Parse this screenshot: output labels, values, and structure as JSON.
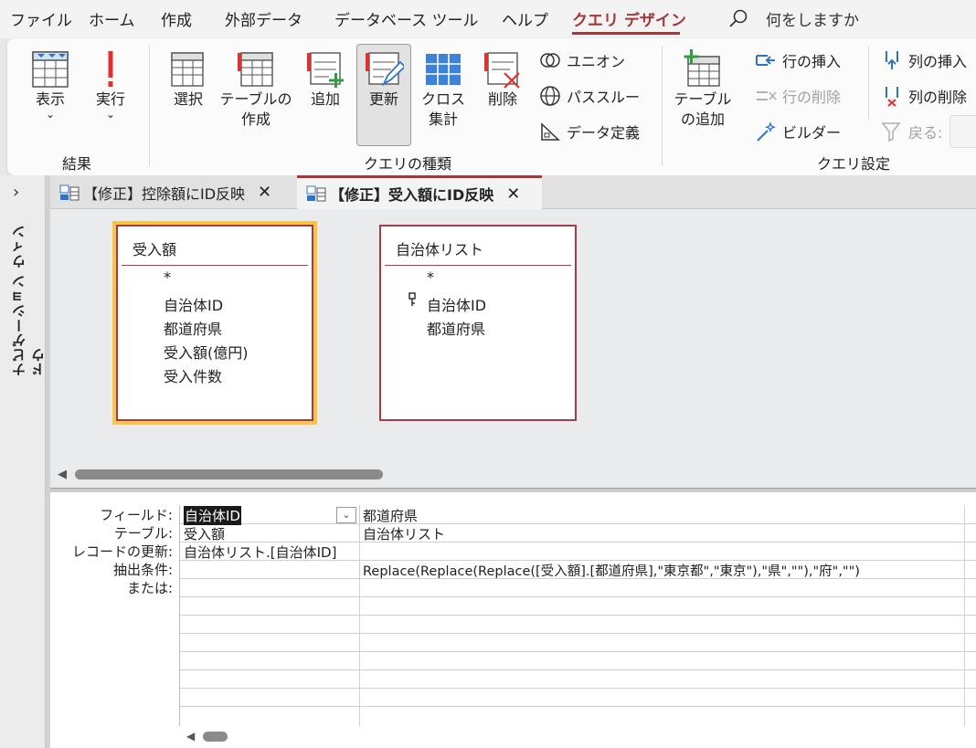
{
  "menu": {
    "file": "ファイル",
    "home": "ホーム",
    "create": "作成",
    "external": "外部データ",
    "dbtools": "データベース ツール",
    "help": "ヘルプ",
    "query_design": "クエリ デザイン",
    "search_placeholder": "何をしますか"
  },
  "ribbon": {
    "results": {
      "view": "表示",
      "run": "実行",
      "group": "結果"
    },
    "query_type": {
      "select": "選択",
      "make_table_1": "テーブルの",
      "make_table_2": "作成",
      "append": "追加",
      "update": "更新",
      "crosstab_1": "クロス",
      "crosstab_2": "集計",
      "delete": "削除",
      "union": "ユニオン",
      "passthrough": "パススルー",
      "data_definition": "データ定義",
      "group": "クエリの種類"
    },
    "query_setup": {
      "add_table_1": "テーブル",
      "add_table_2": "の追加",
      "insert_rows": "行の挿入",
      "delete_rows": "行の削除",
      "builder": "ビルダー",
      "insert_columns": "列の挿入",
      "delete_columns": "列の削除",
      "return": "戻る:",
      "group": "クエリ設定"
    }
  },
  "nav": {
    "title": "ナビゲーション ウィンドウ"
  },
  "tabs": [
    {
      "label": "【修正】控除額にID反映"
    },
    {
      "label": "【修正】受入額にID反映"
    }
  ],
  "tables": [
    {
      "title": "受入額",
      "fields": [
        "*",
        "自治体ID",
        "都道府県",
        "受入額(億円)",
        "受入件数"
      ]
    },
    {
      "title": "自治体リスト",
      "fields": [
        "*",
        "自治体ID",
        "都道府県"
      ]
    }
  ],
  "grid": {
    "row_labels": [
      "フィールド:",
      "テーブル:",
      "レコードの更新:",
      "抽出条件:",
      "または:"
    ],
    "columns": [
      {
        "field": "自治体ID",
        "table": "受入額",
        "update_to": "自治体リスト.[自治体ID]",
        "criteria": ""
      },
      {
        "field": "都道府県",
        "table": "自治体リスト",
        "update_to": "",
        "criteria": "Replace(Replace(Replace([受入額].[都道府県],\"東京都\",\"東京\"),\"県\",\"\"),\"府\",\"\")"
      }
    ]
  },
  "colors": {
    "accent": "#a4373a",
    "table_border": "#a83a48",
    "selected_outline": "#f9c548"
  }
}
